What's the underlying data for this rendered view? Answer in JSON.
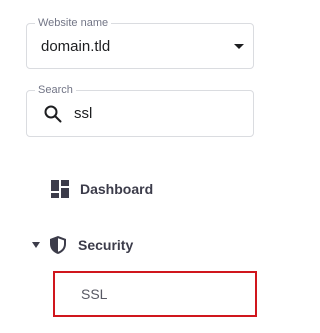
{
  "website_select": {
    "label": "Website name",
    "value": "domain.tld",
    "icon": "chevron-down-icon"
  },
  "search": {
    "label": "Search",
    "value": "ssl",
    "icon": "search-icon"
  },
  "nav": {
    "dashboard": {
      "label": "Dashboard",
      "icon": "dashboard-icon"
    },
    "security": {
      "label": "Security",
      "icon": "shield-icon",
      "expanded": true
    },
    "ssl": {
      "label": "SSL",
      "highlight_color": "#d0161d"
    }
  }
}
